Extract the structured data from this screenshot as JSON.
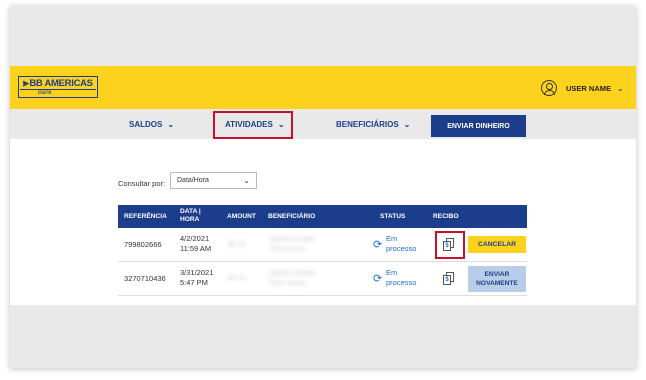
{
  "header": {
    "logo_brand": "BB AMERICAS",
    "logo_sub": "Bank",
    "user_name": "USER NAME",
    "user_chevron": "⌄"
  },
  "nav": {
    "items": [
      {
        "label": "SALDOS",
        "chevron": "⌄"
      },
      {
        "label": "ATIVIDADES",
        "chevron": "⌄"
      },
      {
        "label": "BENEFICIÁRIOS",
        "chevron": "⌄"
      }
    ],
    "send_button": "ENVIAR DINHEIRO"
  },
  "filter": {
    "label": "Consultar por:",
    "selected": "Data/Hora",
    "chevron": "⌄"
  },
  "table": {
    "headers": {
      "ref": "REFERÊNCIA",
      "date_line1": "DATA |",
      "date_line2": "HORA",
      "amount": "AMOUNT",
      "beneficiary": "BENEFICIÁRIO",
      "status": "STATUS",
      "receipt": "RECIBO"
    },
    "rows": [
      {
        "ref": "799802666",
        "date": "4/2/2021",
        "time": "11:59 AM",
        "amount": "$0.15",
        "beneficiary_line1": "Agéfire Gulabs",
        "beneficiary_line2": "Tinto Sunss",
        "status_line1": "Em",
        "status_line2": "processo",
        "action_label": "CANCELAR"
      },
      {
        "ref": "3270710436",
        "date": "3/31/2021",
        "time": "5:47 PM",
        "amount": "$0.15",
        "beneficiary_line1": "Agéfire Gulabs",
        "beneficiary_line2": "Tinto Sunss",
        "status_line1": "Em",
        "status_line2": "processo",
        "action_line1": "ENVIAR",
        "action_line2": "NOVAMENTE"
      }
    ]
  },
  "icons": {
    "refresh": "⟳",
    "receipt_symbol": "$",
    "logo_mark": "⫸"
  },
  "colors": {
    "brand_yellow": "#fcd21c",
    "brand_blue": "#1c3d8c",
    "link_blue": "#1c6fd6",
    "highlight_red": "#c8102e",
    "resend_button": "#b9cde8"
  }
}
